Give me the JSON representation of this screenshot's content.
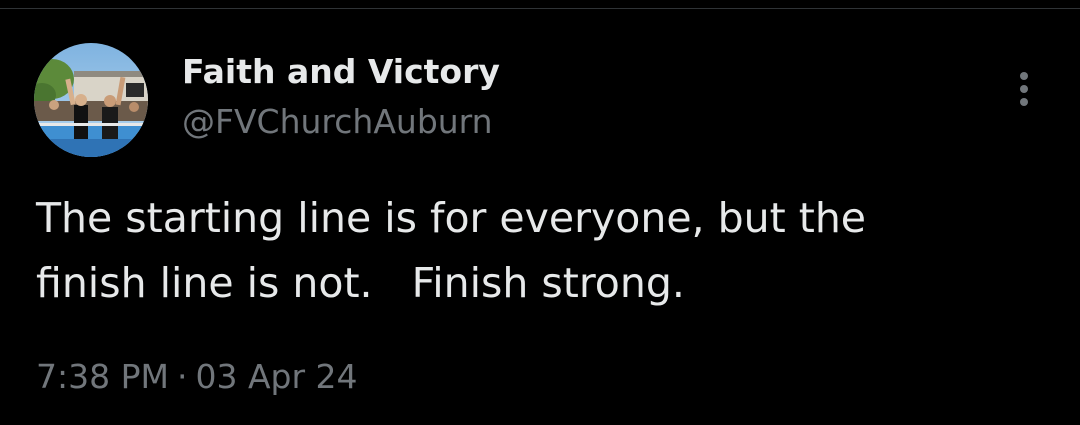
{
  "author": {
    "display_name": "Faith and Victory",
    "handle": "@FVChurchAuburn",
    "avatar_icon": "profile-photo"
  },
  "tweet": {
    "text_line1": "The starting line is for everyone, but the",
    "text_line2": "finish line is not.   Finish strong."
  },
  "meta": {
    "time": "7:38 PM",
    "separator": "·",
    "date": "03 Apr 24"
  },
  "more_icon": "more-vertical",
  "colors": {
    "background": "#000000",
    "primary_text": "#e7e9ea",
    "secondary_text": "#71767b",
    "divider": "#2f3336"
  }
}
